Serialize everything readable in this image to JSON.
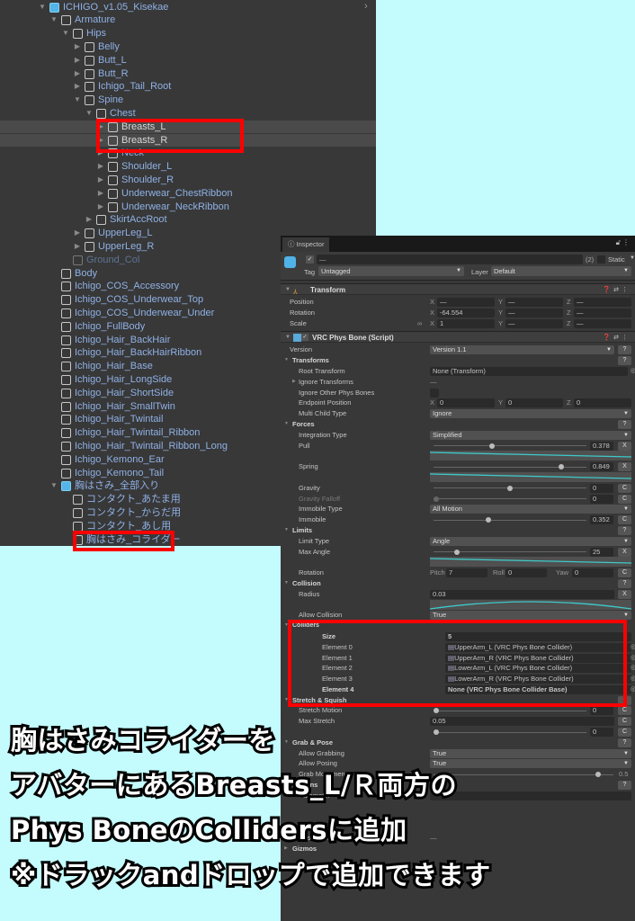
{
  "hierarchy": {
    "items": [
      {
        "label": "ICHIGO_v1.05_Kisekae",
        "level": 0,
        "arrow": "open",
        "icon": "prefab-root"
      },
      {
        "label": "Armature",
        "level": 1,
        "arrow": "open"
      },
      {
        "label": "Hips",
        "level": 2,
        "arrow": "open"
      },
      {
        "label": "Belly",
        "level": 3,
        "arrow": "closed"
      },
      {
        "label": "Butt_L",
        "level": 3,
        "arrow": "closed"
      },
      {
        "label": "Butt_R",
        "level": 3,
        "arrow": "closed"
      },
      {
        "label": "Ichigo_Tail_Root",
        "level": 3,
        "arrow": "closed"
      },
      {
        "label": "Spine",
        "level": 3,
        "arrow": "open"
      },
      {
        "label": "Chest",
        "level": 4,
        "arrow": "open"
      },
      {
        "label": "Breasts_L",
        "level": 5,
        "arrow": "closed",
        "selected": true
      },
      {
        "label": "Breasts_R",
        "level": 5,
        "arrow": "closed",
        "selected": true
      },
      {
        "label": "Neck",
        "level": 5,
        "arrow": "closed"
      },
      {
        "label": "Shoulder_L",
        "level": 5,
        "arrow": "closed"
      },
      {
        "label": "Shoulder_R",
        "level": 5,
        "arrow": "closed"
      },
      {
        "label": "Underwear_ChestRibbon",
        "level": 5,
        "arrow": "closed"
      },
      {
        "label": "Underwear_NeckRibbon",
        "level": 5,
        "arrow": "closed"
      },
      {
        "label": "SkirtAccRoot",
        "level": 4,
        "arrow": "closed"
      },
      {
        "label": "UpperLeg_L",
        "level": 3,
        "arrow": "closed"
      },
      {
        "label": "UpperLeg_R",
        "level": 3,
        "arrow": "closed"
      },
      {
        "label": "Ground_Col",
        "level": 2,
        "arrow": "none",
        "inactive": true
      },
      {
        "label": "Body",
        "level": 1,
        "arrow": "none"
      },
      {
        "label": "Ichigo_COS_Accessory",
        "level": 1,
        "arrow": "none"
      },
      {
        "label": "Ichigo_COS_Underwear_Top",
        "level": 1,
        "arrow": "none"
      },
      {
        "label": "Ichigo_COS_Underwear_Under",
        "level": 1,
        "arrow": "none"
      },
      {
        "label": "Ichigo_FullBody",
        "level": 1,
        "arrow": "none"
      },
      {
        "label": "Ichigo_Hair_BackHair",
        "level": 1,
        "arrow": "none"
      },
      {
        "label": "Ichigo_Hair_BackHairRibbon",
        "level": 1,
        "arrow": "none"
      },
      {
        "label": "Ichigo_Hair_Base",
        "level": 1,
        "arrow": "none"
      },
      {
        "label": "Ichigo_Hair_LongSide",
        "level": 1,
        "arrow": "none"
      },
      {
        "label": "Ichigo_Hair_ShortSide",
        "level": 1,
        "arrow": "none"
      },
      {
        "label": "Ichigo_Hair_SmallTwin",
        "level": 1,
        "arrow": "none"
      },
      {
        "label": "Ichigo_Hair_Twintail",
        "level": 1,
        "arrow": "none"
      },
      {
        "label": "Ichigo_Hair_Twintail_Ribbon",
        "level": 1,
        "arrow": "none"
      },
      {
        "label": "Ichigo_Hair_Twintail_Ribbon_Long",
        "level": 1,
        "arrow": "none"
      },
      {
        "label": "Ichigo_Kemono_Ear",
        "level": 1,
        "arrow": "none"
      },
      {
        "label": "Ichigo_Kemono_Tail",
        "level": 1,
        "arrow": "none"
      },
      {
        "label": "胸はさみ_全部入り",
        "level": 1,
        "arrow": "open",
        "icon": "prefab-added"
      },
      {
        "label": "コンタクト_あたま用",
        "level": 2,
        "arrow": "none"
      },
      {
        "label": "コンタクト_からだ用",
        "level": 2,
        "arrow": "none"
      },
      {
        "label": "コンタクト_あし用",
        "level": 2,
        "arrow": "none"
      },
      {
        "label": "胸はさみ_コライダー",
        "level": 2,
        "arrow": "none"
      }
    ]
  },
  "inspector": {
    "tab_label": "Inspector",
    "object": {
      "name": "—",
      "count": "(2)",
      "static_label": "Static",
      "tag_label": "Tag",
      "tag_value": "Untagged",
      "layer_label": "Layer",
      "layer_value": "Default"
    },
    "rows": [
      {
        "t": "chdr",
        "title": "Transform",
        "icon": "transform"
      },
      {
        "t": "vec3",
        "label": "Position",
        "x": "—",
        "y": "—",
        "z": "—"
      },
      {
        "t": "vec3",
        "label": "Rotation",
        "x": "-64.554",
        "y": "—",
        "z": "—"
      },
      {
        "t": "vec3",
        "label": "Scale",
        "x": "1",
        "y": "—",
        "z": "—",
        "link": true
      },
      {
        "t": "chdr",
        "title": "VRC Phys Bone (Script)",
        "icon": "script",
        "check": true
      },
      {
        "t": "dd",
        "label": "Version",
        "value": "Version 1.1",
        "help": "?"
      },
      {
        "t": "sec",
        "label": "Transforms",
        "help": "?"
      },
      {
        "t": "obj",
        "label": "Root Transform",
        "value": "None (Transform)",
        "sub": true
      },
      {
        "t": "dash",
        "label": "Ignore Transforms",
        "sub": true,
        "fold": true
      },
      {
        "t": "check",
        "label": "Ignore Other Phys Bones",
        "sub": true
      },
      {
        "t": "vec3",
        "label": "Endpoint Position",
        "x": "0",
        "y": "0",
        "z": "0",
        "sub": true
      },
      {
        "t": "dd",
        "label": "Multi Child Type",
        "value": "Ignore",
        "sub": true
      },
      {
        "t": "sec",
        "label": "Forces",
        "help": "?"
      },
      {
        "t": "dd",
        "label": "Integration Type",
        "value": "Simplified",
        "sub": true
      },
      {
        "t": "slider",
        "label": "Pull",
        "value": "0.378",
        "frac": 0.378,
        "btn": "X",
        "sub": true
      },
      {
        "t": "curve",
        "shape": "down"
      },
      {
        "t": "slider",
        "label": "Spring",
        "value": "0.849",
        "frac": 0.849,
        "btn": "X",
        "sub": true
      },
      {
        "t": "curve",
        "shape": "down"
      },
      {
        "t": "slider",
        "label": "Gravity",
        "value": "0",
        "frac": 0.5,
        "btn": "C",
        "sub": true
      },
      {
        "t": "slider",
        "label": "Gravity Falloff",
        "value": "0",
        "frac": 0,
        "btn": "C",
        "sub": true,
        "disabled": true
      },
      {
        "t": "dd",
        "label": "Immobile Type",
        "value": "All Motion",
        "sub": true
      },
      {
        "t": "slider",
        "label": "Immobile",
        "value": "0.352",
        "frac": 0.352,
        "btn": "C",
        "sub": true
      },
      {
        "t": "sec",
        "label": "Limits",
        "help": "?"
      },
      {
        "t": "dd",
        "label": "Limit Type",
        "value": "Angle",
        "sub": true
      },
      {
        "t": "slider",
        "label": "Max Angle",
        "value": "25",
        "frac": 0.14,
        "btn": "X",
        "sub": true
      },
      {
        "t": "curve",
        "shape": "down"
      },
      {
        "t": "rot",
        "label": "Rotation",
        "pitch_label": "Pitch",
        "pitch": "7",
        "roll_label": "Roll",
        "roll": "0",
        "yaw_label": "Yaw",
        "yaw": "0",
        "btn": "C",
        "sub": true
      },
      {
        "t": "sec",
        "label": "Collision",
        "help": "?"
      },
      {
        "t": "text",
        "label": "Radius",
        "value": "0.03",
        "btn": "X",
        "sub": true
      },
      {
        "t": "curve",
        "shape": "bump"
      },
      {
        "t": "dd",
        "label": "Allow Collision",
        "value": "True",
        "sub": true
      },
      {
        "t": "sec",
        "label": "Colliders",
        "small": true
      },
      {
        "t": "text",
        "label": "Size",
        "value": "5",
        "bold": true,
        "el": true
      },
      {
        "t": "obj",
        "label": "Element 0",
        "value": "UpperArm_L (VRC Phys Bone Collider)",
        "el": true,
        "fileicon": true
      },
      {
        "t": "obj",
        "label": "Element 1",
        "value": "UpperArm_R (VRC Phys Bone Collider)",
        "el": true,
        "fileicon": true
      },
      {
        "t": "obj",
        "label": "Element 2",
        "value": "LowerArm_L (VRC Phys Bone Collider)",
        "el": true,
        "fileicon": true
      },
      {
        "t": "obj",
        "label": "Element 3",
        "value": "LowerArm_R (VRC Phys Bone Collider)",
        "el": true,
        "fileicon": true
      },
      {
        "t": "obj",
        "label": "Element 4",
        "value": "None (VRC Phys Bone Collider Base)",
        "el": true,
        "bold": true
      },
      {
        "t": "sec",
        "label": "Stretch & Squish",
        "help": "?"
      },
      {
        "t": "slider",
        "label": "Stretch Motion",
        "value": "0",
        "frac": 0,
        "btn": "C",
        "sub": true
      },
      {
        "t": "text",
        "label": "Max Stretch",
        "value": "0.05",
        "btn": "C",
        "sub": true
      },
      {
        "t": "slider",
        "label": "",
        "value": "0",
        "frac": 0,
        "btn": "C",
        "sub": true
      },
      {
        "t": "sec",
        "label": "Grab & Pose",
        "help": "?"
      },
      {
        "t": "dd",
        "label": "Allow Grabbing",
        "value": "True",
        "sub": true
      },
      {
        "t": "dd",
        "label": "Allow Posing",
        "value": "True",
        "sub": true
      },
      {
        "t": "slider",
        "label": "Grab Movement",
        "value": "0.5",
        "frac": 1,
        "sub": true
      },
      {
        "t": "sec",
        "label": "Options",
        "help": "?"
      },
      {
        "t": "text",
        "label": "Parameter",
        "value": "",
        "sub": true
      },
      {
        "t": "blank"
      },
      {
        "t": "blank"
      },
      {
        "t": "blank"
      },
      {
        "t": "dash",
        "label": "Reset When Disabled",
        "sub": true
      },
      {
        "t": "sec",
        "label": "Gizmos",
        "closed": true
      }
    ]
  },
  "overlay": {
    "lines": [
      "胸はさみコライダーを",
      "アバターにあるBreasts_L/Ｒ両方の",
      "Phys BoneのCollidersに追加",
      "※ドラックandドロップで追加できます"
    ]
  },
  "colors": {
    "highlight": "#ff0000",
    "hierarchy_text": "#8fb1e6",
    "curve": "#3fc8c8"
  }
}
